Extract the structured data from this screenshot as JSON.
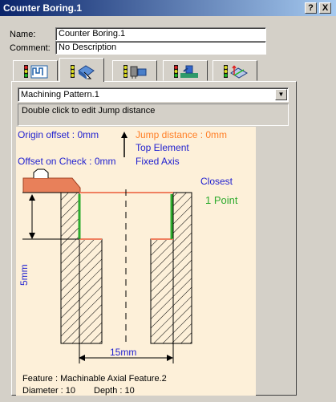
{
  "window": {
    "title": "Counter Boring.1",
    "help_label": "?",
    "close_label": "X"
  },
  "form": {
    "name_label": "Name:",
    "name_value": "Counter Boring.1",
    "comment_label": "Comment:",
    "comment_value": "No Description"
  },
  "tabs": [
    {
      "icon": "strategy-tab-icon"
    },
    {
      "icon": "geometry-tab-icon",
      "active": true
    },
    {
      "icon": "tool-tab-icon"
    },
    {
      "icon": "feeds-speeds-tab-icon"
    },
    {
      "icon": "macro-tab-icon"
    }
  ],
  "geometry": {
    "pattern_select": "Machining Pattern.1",
    "message": "Double click to edit Jump distance"
  },
  "drawing": {
    "origin_offset": "Origin offset : 0mm",
    "offset_on_check": "Offset on Check : 0mm",
    "jump_distance": "Jump distance : 0mm",
    "top_element": "Top Element",
    "fixed_axis": "Fixed Axis",
    "closest": "Closest",
    "one_point": "1 Point",
    "depth_dim": "5mm",
    "width_dim": "15mm",
    "feature": "Feature : Machinable Axial Feature.2",
    "diameter": "Diameter : 10",
    "depth": "Depth : 10"
  },
  "colors": {
    "title_blue": "#0a246a",
    "label_blue": "#1f1fd0",
    "jump_orange": "#ff7f27",
    "point_green": "#2eab2e",
    "salmon": "#f08060",
    "canvas": "#fdf0d9"
  }
}
